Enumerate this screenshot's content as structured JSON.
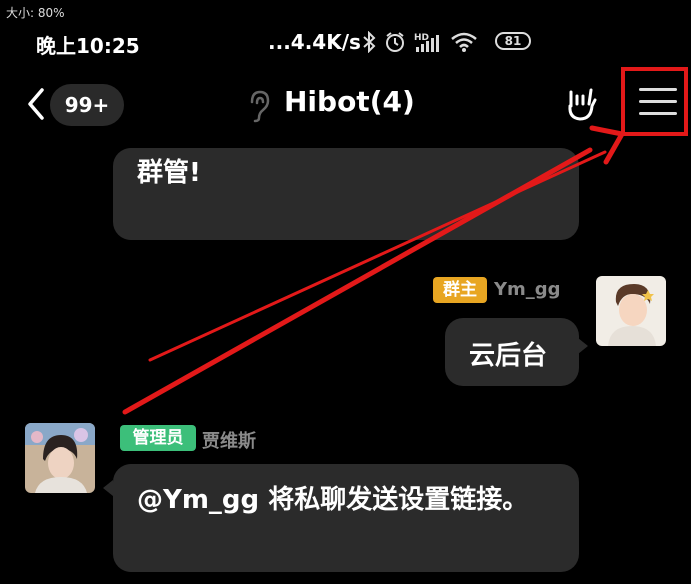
{
  "overlay": {
    "size_label": "大小: 80%"
  },
  "statusbar": {
    "time": "晚上10:25",
    "speed": "...4.4K/s",
    "battery": "81",
    "icons": [
      "bluetooth-icon",
      "alarm-icon",
      "hd-signal-icon",
      "wifi-icon",
      "battery-icon"
    ]
  },
  "header": {
    "unread_count": "99+",
    "title": "Hibot(4)",
    "icons": [
      "back-chevron-icon",
      "earpiece-icon",
      "hand-gesture-icon",
      "menu-icon"
    ]
  },
  "messages": [
    {
      "text": "群管!",
      "side": "left"
    },
    {
      "role": "群主",
      "sender": "Ym_gg",
      "text": "云后台",
      "side": "right"
    },
    {
      "role": "管理员",
      "sender": "贾维斯",
      "text": "@Ym_gg 将私聊发送设置链接。",
      "side": "left"
    }
  ],
  "colors": {
    "background": "#000000",
    "bubble": "#2b2b2b",
    "owner_badge": "#e8a622",
    "admin_badge": "#3cbf7a",
    "annotation_red": "#e31919"
  }
}
